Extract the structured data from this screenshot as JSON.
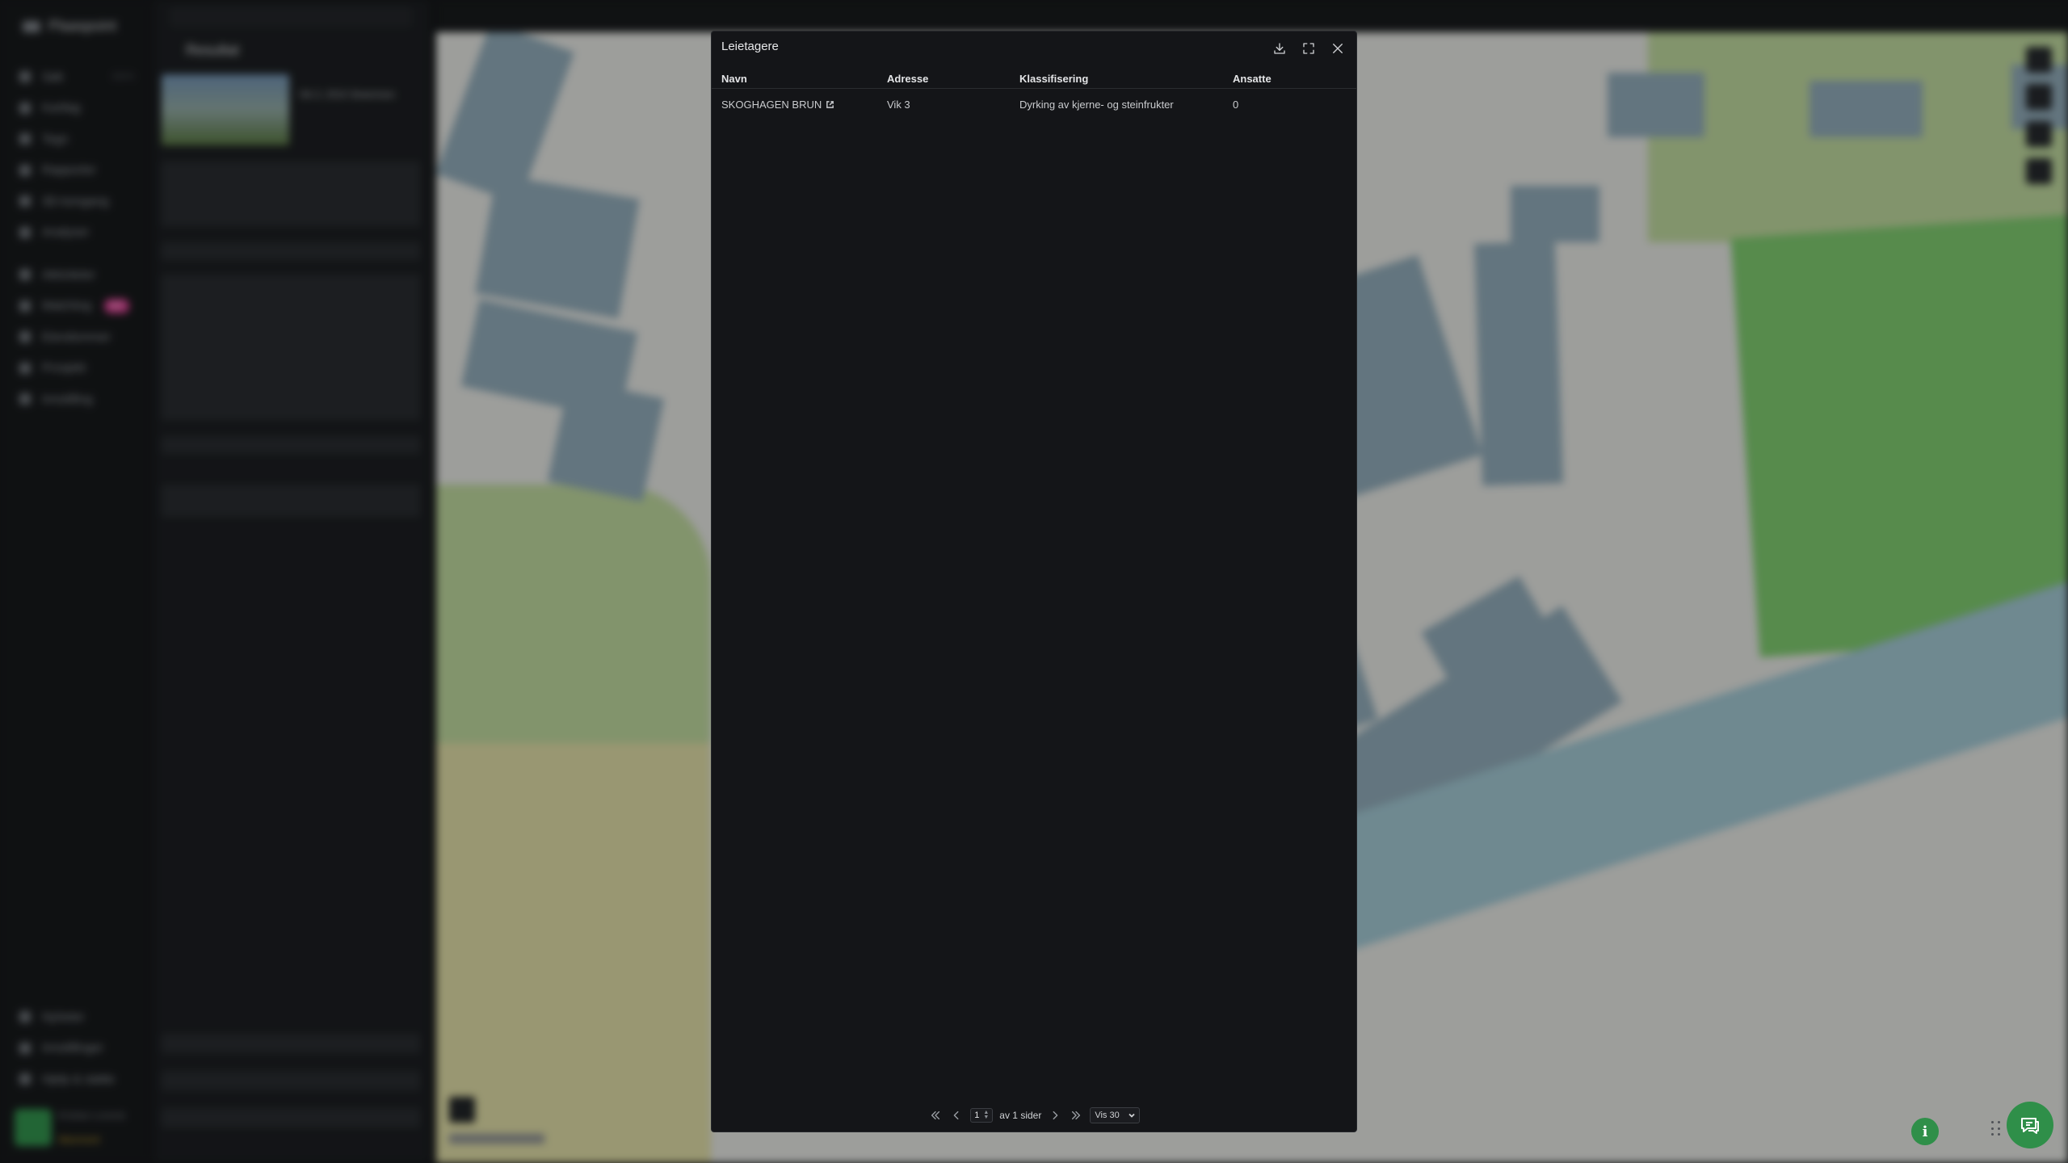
{
  "sidebar": {
    "app_name": "Plaaspoint",
    "items": [
      {
        "label": "Søk",
        "shortcut": "Ctrl K"
      },
      {
        "label": "Kartlag"
      },
      {
        "label": "Tegn"
      },
      {
        "label": "Rapporter"
      },
      {
        "label": "3D-tomgang"
      },
      {
        "label": "Analyser"
      },
      {
        "label": "Aktiviteter"
      },
      {
        "label": "Matching",
        "badge": "NY"
      },
      {
        "label": "Eiendommer"
      },
      {
        "label": "Prosjekt"
      },
      {
        "label": "Innstilling"
      }
    ],
    "bottom_items": [
      {
        "label": "Nyheter"
      },
      {
        "label": "Innstillinger"
      },
      {
        "label": "Hjelp & støtte"
      }
    ],
    "user": {
      "name": "Kristian Lorentz",
      "status": "Abonnent"
    }
  },
  "panel": {
    "title": "Resultat",
    "address": "Vik 3, 2010 Strømmen"
  },
  "modal": {
    "title": "Leietagere",
    "columns": [
      "Navn",
      "Adresse",
      "Klassifisering",
      "Ansatte"
    ],
    "rows": [
      {
        "name": "SKOGHAGEN BRUN",
        "address": "Vik 3",
        "classification": "Dyrking av kjerne- og steinfrukter",
        "employees": "0"
      }
    ],
    "pagination": {
      "current_page": "1",
      "of_pages_text": "av 1 sider",
      "page_size_label": "Vis 30"
    }
  },
  "colors": {
    "accent": "#2f8f49",
    "modal_bg": "#141518",
    "badge": "#d43a8c"
  }
}
